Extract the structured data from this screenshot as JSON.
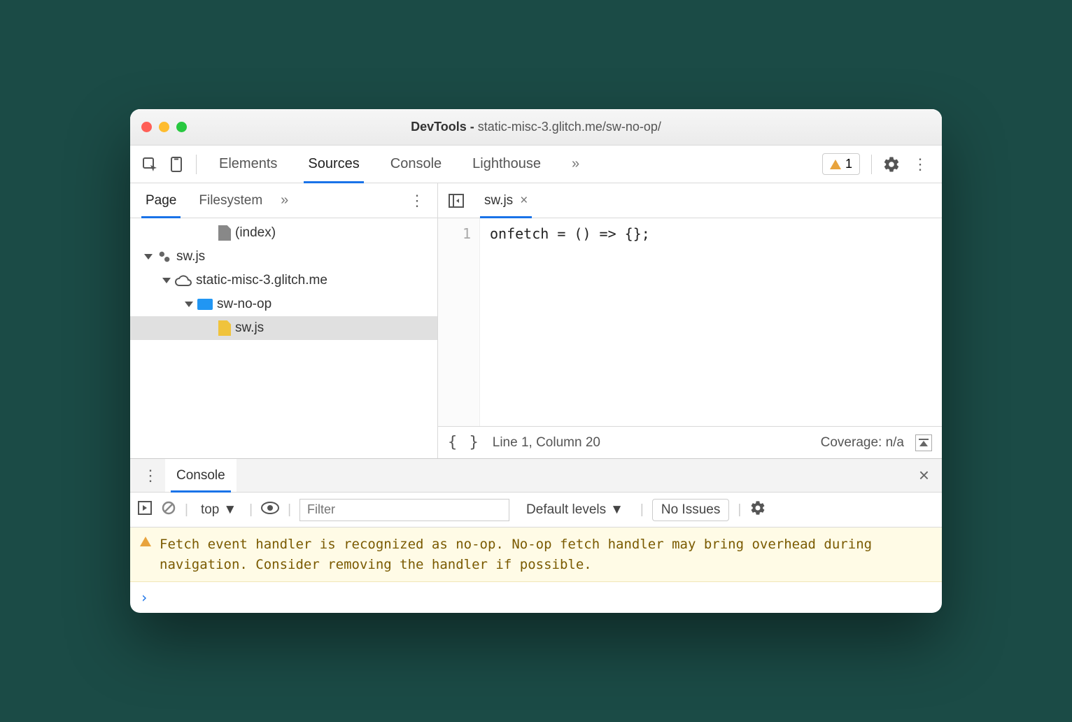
{
  "window": {
    "title_prefix": "DevTools - ",
    "title_path": "static-misc-3.glitch.me/sw-no-op/"
  },
  "toolbar": {
    "tabs": [
      "Elements",
      "Sources",
      "Console",
      "Lighthouse"
    ],
    "active_tab": "Sources",
    "warning_count": "1"
  },
  "sources": {
    "subtabs": [
      "Page",
      "Filesystem"
    ],
    "active_subtab": "Page",
    "tree": {
      "index_label": "(index)",
      "sw_label": "sw.js",
      "domain_label": "static-misc-3.glitch.me",
      "folder_label": "sw-no-op",
      "file_label": "sw.js"
    },
    "open_file": "sw.js",
    "code_line_num": "1",
    "code_line": "onfetch = () => {};",
    "status_pos": "Line 1, Column 20",
    "status_coverage": "Coverage: n/a"
  },
  "console": {
    "tab_label": "Console",
    "context": "top",
    "filter_placeholder": "Filter",
    "levels_label": "Default levels",
    "issues_label": "No Issues",
    "warning_text": "Fetch event handler is recognized as no-op. No-op fetch handler may bring overhead during navigation. Consider removing the handler if possible."
  }
}
